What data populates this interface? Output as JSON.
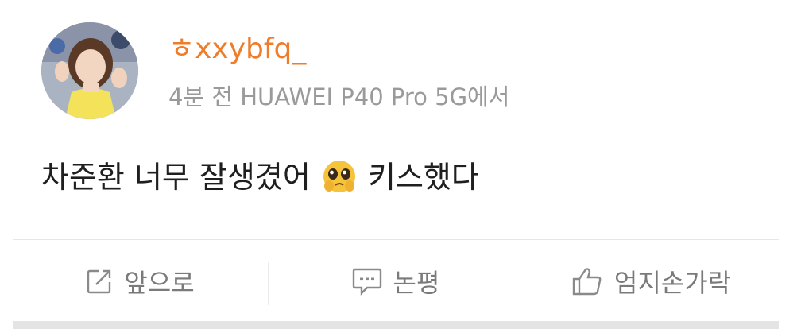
{
  "post": {
    "username": "ㅎxxybfq_",
    "meta": "4분 전 HUAWEI P40 Pro 5G에서",
    "text_before": "차준환 너무 잘생겼어",
    "emoji": "pleading-face-emoji",
    "text_after": "키스했다"
  },
  "actions": {
    "forward_label": "앞으로",
    "comment_label": "논평",
    "like_label": "엄지손가락"
  },
  "colors": {
    "username": "#f07c2a",
    "meta": "#9a9a9a",
    "text": "#1f1f1f",
    "action": "#7a7a7a"
  },
  "icons": [
    "share-icon",
    "comment-icon",
    "thumbs-up-icon"
  ]
}
